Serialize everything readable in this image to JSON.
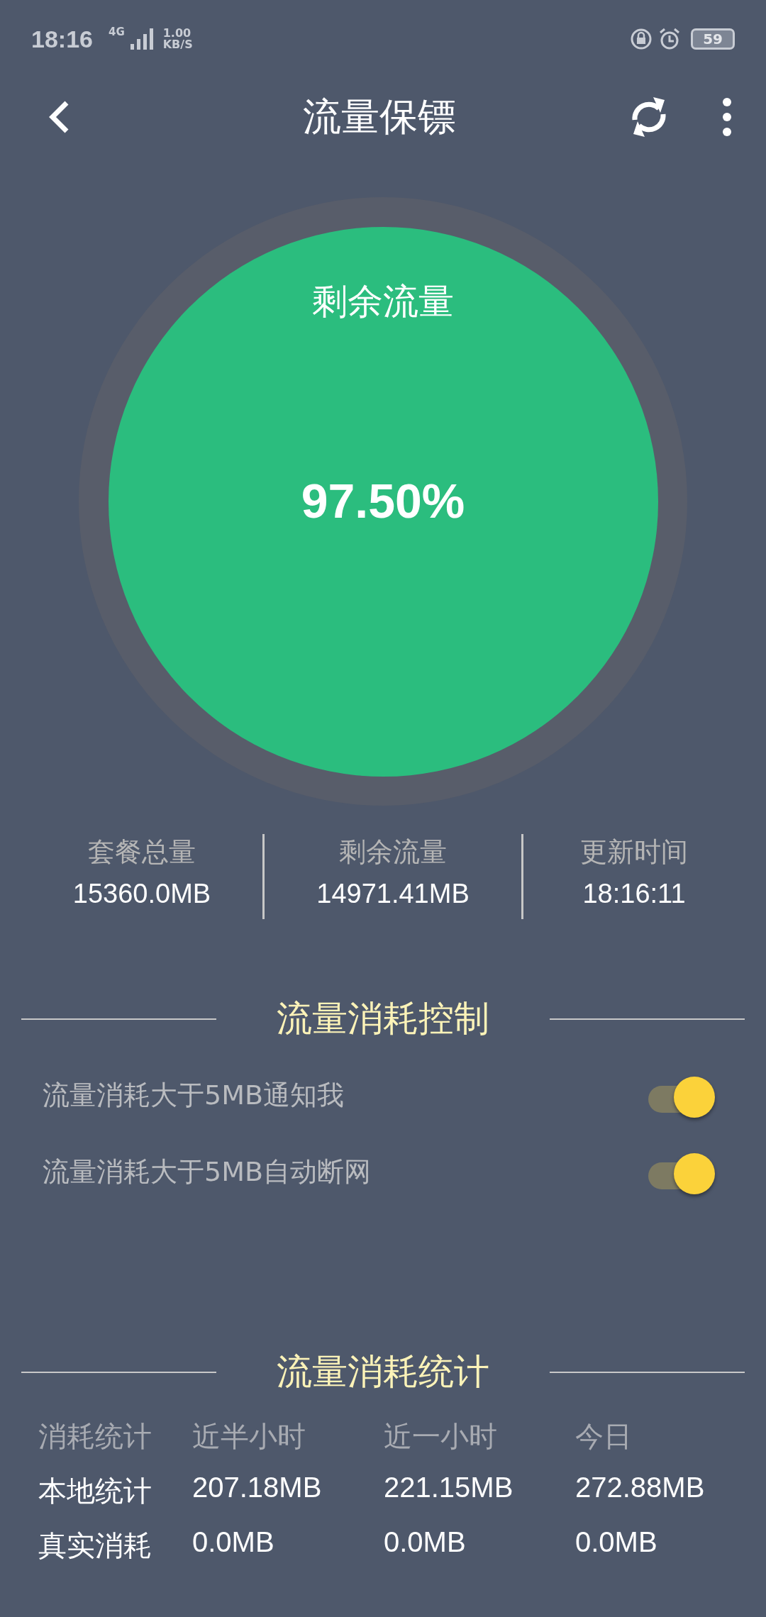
{
  "status_bar": {
    "time": "18:16",
    "network": "4G",
    "speed_value": "1.00",
    "speed_unit": "KB/S",
    "battery": "59"
  },
  "app_bar": {
    "title": "流量保镖"
  },
  "gauge": {
    "label": "剩余流量",
    "value": "97.50%"
  },
  "summary": [
    {
      "label": "套餐总量",
      "value": "15360.0MB"
    },
    {
      "label": "剩余流量",
      "value": "14971.41MB"
    },
    {
      "label": "更新时间",
      "value": "18:16:11"
    }
  ],
  "control_section": {
    "title": "流量消耗控制",
    "options": [
      {
        "label": "流量消耗大于5MB通知我",
        "on": true
      },
      {
        "label": "流量消耗大于5MB自动断网",
        "on": true
      }
    ]
  },
  "stats_section": {
    "title": "流量消耗统计",
    "columns": [
      "消耗统计",
      "近半小时",
      "近一小时",
      "今日"
    ],
    "rows": [
      {
        "cells": [
          "本地统计",
          "207.18MB",
          "221.15MB",
          "272.88MB"
        ]
      },
      {
        "cells": [
          "真实消耗",
          "0.0MB",
          "0.0MB",
          "0.0MB"
        ]
      }
    ]
  }
}
